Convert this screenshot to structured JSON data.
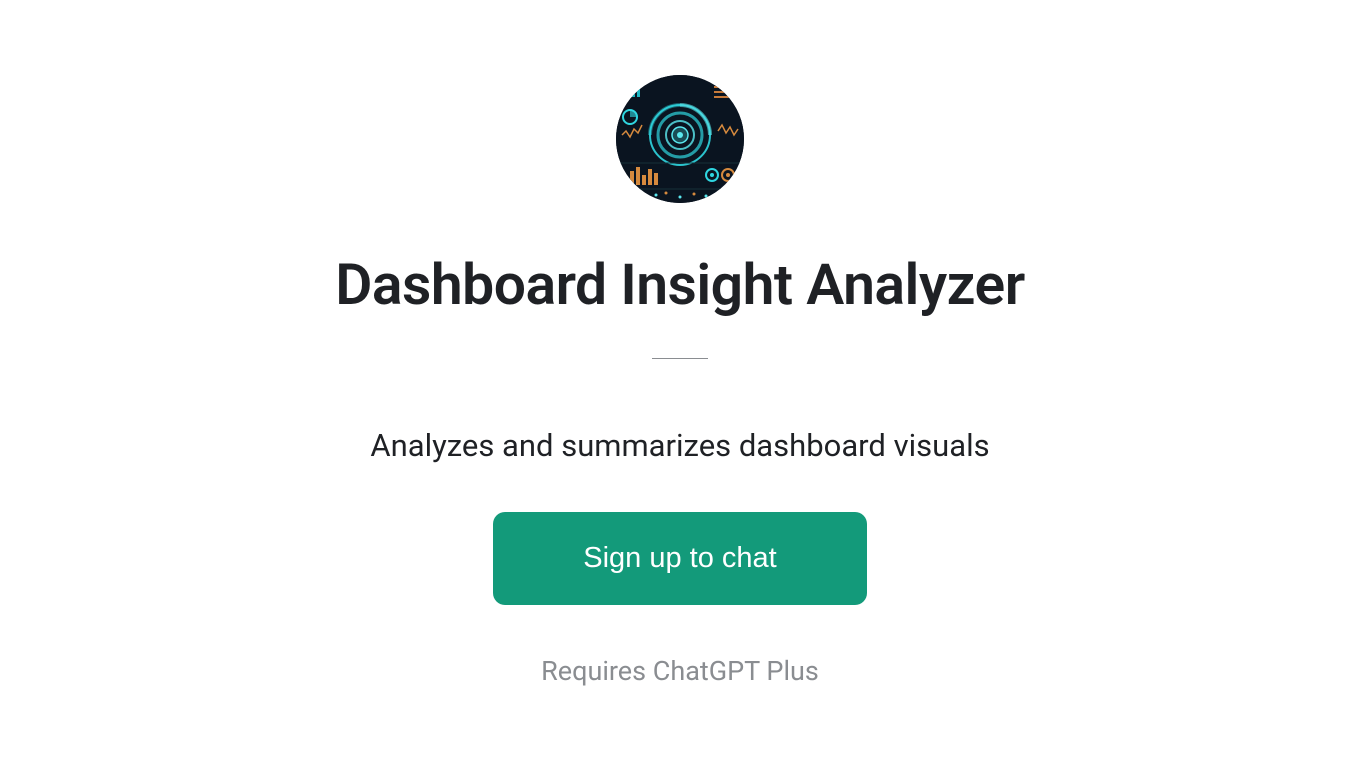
{
  "title": "Dashboard Insight Analyzer",
  "subtitle": "Analyzes and summarizes dashboard visuals",
  "cta_label": "Sign up to chat",
  "footer_text": "Requires ChatGPT Plus"
}
